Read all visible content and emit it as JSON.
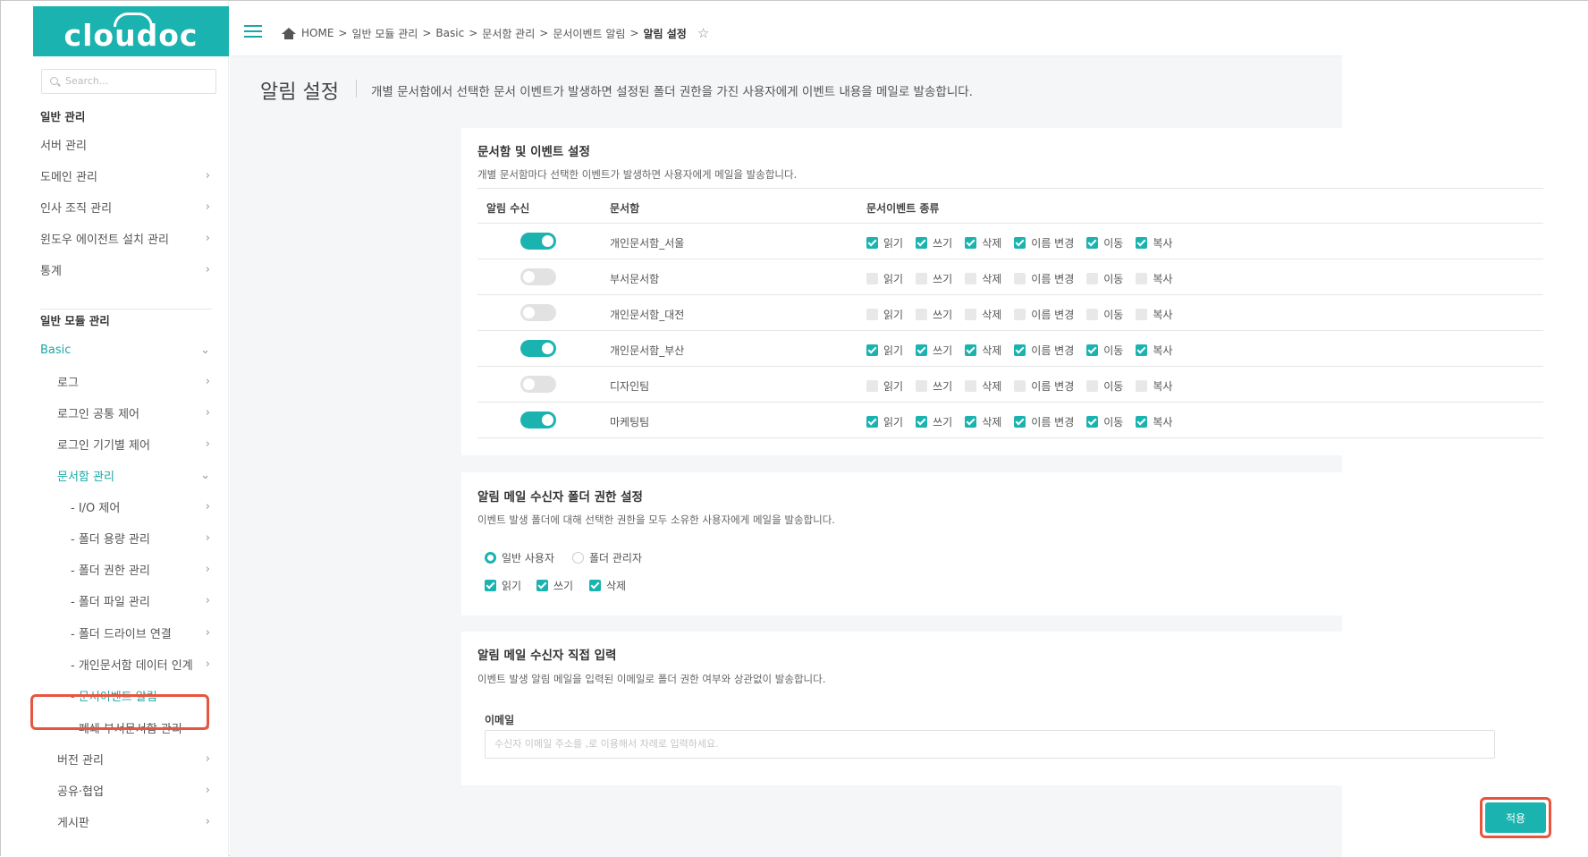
{
  "logo": {
    "text": "cloudoc"
  },
  "search": {
    "placeholder": "Search..."
  },
  "sidebar": {
    "items": [
      {
        "label": "일반 관리",
        "type": "head"
      },
      {
        "label": "서버 관리",
        "chev": false
      },
      {
        "label": "도메인 관리",
        "chev": true
      },
      {
        "label": "인사 조직 관리",
        "chev": true
      },
      {
        "label": "윈도우 에이전트 설치 관리",
        "chev": true
      },
      {
        "label": "통계",
        "chev": true
      },
      {
        "label": "일반 모듈 관리",
        "type": "head"
      },
      {
        "label": "Basic",
        "active": true
      },
      {
        "label": "로그"
      },
      {
        "label": "로그인 공통 제어"
      },
      {
        "label": "로그인 기기별 제어"
      },
      {
        "label": "문서함 관리",
        "active": true
      },
      {
        "label": "- I/O 제어"
      },
      {
        "label": "- 폴더 용량 관리"
      },
      {
        "label": "- 폴더 권한 관리"
      },
      {
        "label": "- 폴더 파일 관리"
      },
      {
        "label": "- 폴더 드라이브 연결"
      },
      {
        "label": "- 개인문서함 데이터 인계"
      },
      {
        "label": "- 문서이벤트 알림",
        "active": true,
        "selected": true
      },
      {
        "label": "- 폐쇄 부서문서함 관리"
      },
      {
        "label": "버전 관리"
      },
      {
        "label": "공유·협업"
      },
      {
        "label": "게시판"
      }
    ]
  },
  "breadcrumb": {
    "items": [
      "HOME",
      "일반 모듈 관리",
      "Basic",
      "문서함 관리",
      "문서이벤트 알림",
      "알림 설정"
    ],
    "separator": ">"
  },
  "page": {
    "title": "알림 설정",
    "description": "개별 문서함에서 선택한 문서 이벤트가 발생하면 설정된 폴더 권한을 가진 사용자에게 이벤트 내용을 메일로 발송합니다."
  },
  "events_card": {
    "title": "문서함 및 이벤트 설정",
    "description": "개별 문서함마다 선택한 이벤트가 발생하면 사용자에게 메일을 발송합니다.",
    "headers": [
      "알림 수신",
      "문서함",
      "문서이벤트 종류"
    ],
    "event_types": [
      "읽기",
      "쓰기",
      "삭제",
      "이름 변경",
      "이동",
      "복사"
    ],
    "rows": [
      {
        "enabled": true,
        "name": "개인문서함_서울"
      },
      {
        "enabled": false,
        "name": "부서문서함"
      },
      {
        "enabled": false,
        "name": "개인문서함_대전"
      },
      {
        "enabled": true,
        "name": "개인문서함_부산"
      },
      {
        "enabled": false,
        "name": "디자인팀"
      },
      {
        "enabled": true,
        "name": "마케팅팀"
      }
    ]
  },
  "folder_perm_card": {
    "title": "알림 메일 수신자 폴더 권한 설정",
    "description": "이벤트 발생 폴더에 대해 선택한 권한을 모두 소유한 사용자에게 메일을 발송합니다.",
    "radio_user": "일반 사용자",
    "radio_admin": "폴더 관리자",
    "selected_radio": "일반 사용자",
    "perm_read": "읽기",
    "perm_write": "쓰기",
    "perm_delete": "삭제"
  },
  "direct_input_card": {
    "title": "알림 메일 수신자 직접 입력",
    "description": "이벤트 발생 알림 메일을 입력된 이메일로 폴더 권한 여부와 상관없이 발송합니다.",
    "email_label": "이메일",
    "email_placeholder": "수신자 이메일 주소를 ,로 이용해서 차례로 입력하세요."
  },
  "apply_button": "적용",
  "colors": {
    "accent": "#1bb3b0",
    "highlight": "#e8553e"
  }
}
